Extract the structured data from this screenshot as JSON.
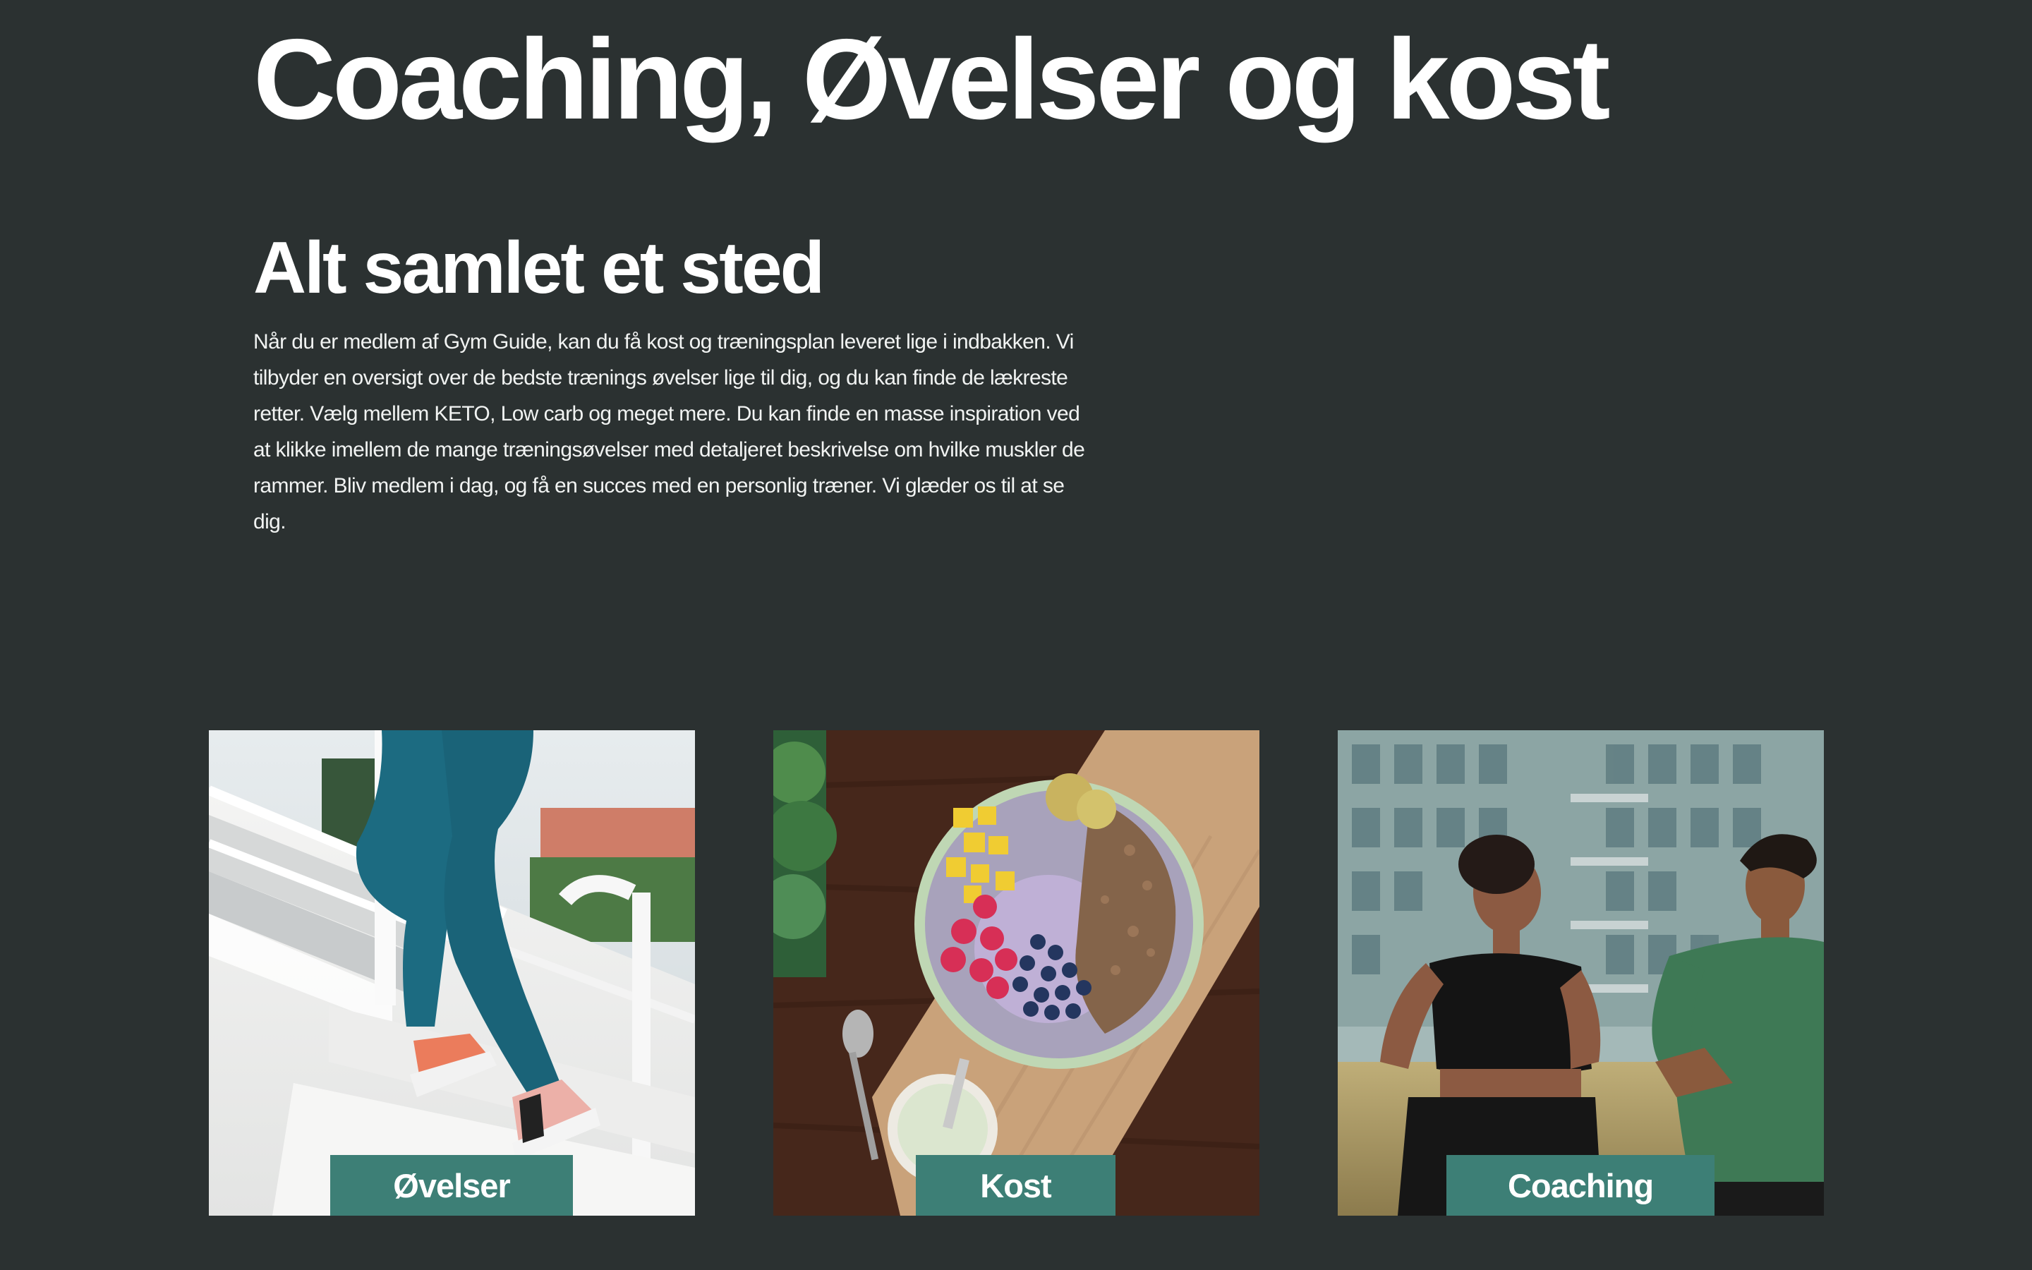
{
  "hero": {
    "title": "Coaching, Øvelser og kost",
    "subtitle": "Alt samlet et sted",
    "description": "Når du er medlem af Gym Guide, kan du få kost og træningsplan leveret lige i indbakken. Vi tilbyder en oversigt over de bedste trænings øvelser lige til dig, og du kan finde de lækreste retter. Vælg mellem KETO, Low carb og meget mere. Du kan finde en masse inspiration ved at klikke imellem de mange træningsøvelser med detaljeret beskrivelse om hvilke muskler de rammer. Bliv medlem i dag, og få en succes med en personlig træner. Vi glæder os til at se dig."
  },
  "cards": [
    {
      "label": "Øvelser"
    },
    {
      "label": "Kost"
    },
    {
      "label": "Coaching"
    }
  ],
  "colors": {
    "background": "#2b3131",
    "label_background": "#3d7f76",
    "text": "#ffffff"
  }
}
